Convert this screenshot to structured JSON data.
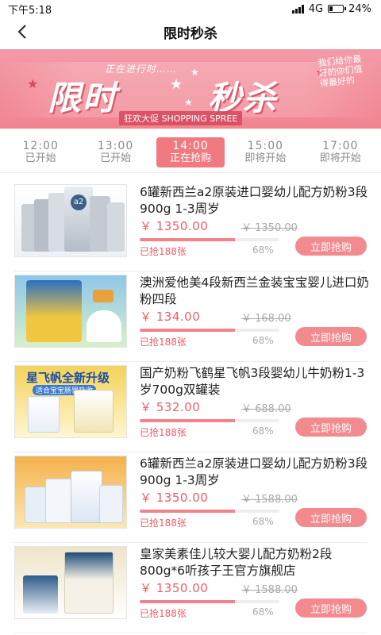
{
  "status_bar": {
    "time": "下午5:18",
    "network": "4G",
    "battery": "24%"
  },
  "nav": {
    "title": "限时秒杀"
  },
  "banner": {
    "subtitle": "正在进行时……",
    "headline_left": "限时",
    "headline_right": "秒杀",
    "caption": "狂欢大促 SHOPPING SPREE",
    "side_text": "我们给你最好的你们值得最好的"
  },
  "time_tabs": [
    {
      "time": "12:00",
      "status": "已开始"
    },
    {
      "time": "13:00",
      "status": "已开始"
    },
    {
      "time": "14:00",
      "status": "正在抢购"
    },
    {
      "time": "15:00",
      "status": "即将开始"
    },
    {
      "time": "17:00",
      "status": "即将开始"
    }
  ],
  "active_tab_index": 2,
  "products": [
    {
      "name": "6罐新西兰a2原装进口婴幼儿配方奶粉3段 900g 1-3周岁",
      "price": "￥ 1350.00",
      "original_price": "￥ 1350.00",
      "sold": "已抢188张",
      "percent": "68%",
      "progress": 0.68,
      "button": "立即抢购",
      "image": "a2-platinum-cans"
    },
    {
      "name": "澳洲爱他美4段新西兰金装宝宝婴儿进口奶粉四段",
      "price": "￥ 134.00",
      "original_price": "￥ 168.00",
      "sold": "已抢188张",
      "percent": "68%",
      "progress": 0.68,
      "button": "立即抢购",
      "image": "aptamil-junior-can"
    },
    {
      "name": "国产奶粉飞鹤星飞帆3段婴幼儿牛奶粉1-3岁700g双罐装",
      "price": "￥ 532.00",
      "original_price": "￥ 688.00",
      "sold": "已抢188张",
      "percent": "68%",
      "progress": 0.68,
      "button": "立即抢购",
      "image": "feihe-cans",
      "image_text": "星飞帆全新升级",
      "image_subtext": "适合宝宝肠胃吸收"
    },
    {
      "name": "6罐新西兰a2原装进口婴幼儿配方奶粉3段 900g 1-3周岁",
      "price": "￥ 1350.00",
      "original_price": "￥ 1588.00",
      "sold": "已抢188张",
      "percent": "68%",
      "progress": 0.68,
      "button": "立即抢购",
      "image": "formula-cans"
    },
    {
      "name": "皇家美素佳儿较大婴儿配方奶粉2段800g*6听孩子王官方旗舰店",
      "price": "￥ 1350.00",
      "original_price": "￥ 1588.00",
      "sold": "已抢188张",
      "percent": "68%",
      "progress": 0.68,
      "button": "立即抢购",
      "image": "friso-prestige-cans"
    }
  ]
}
